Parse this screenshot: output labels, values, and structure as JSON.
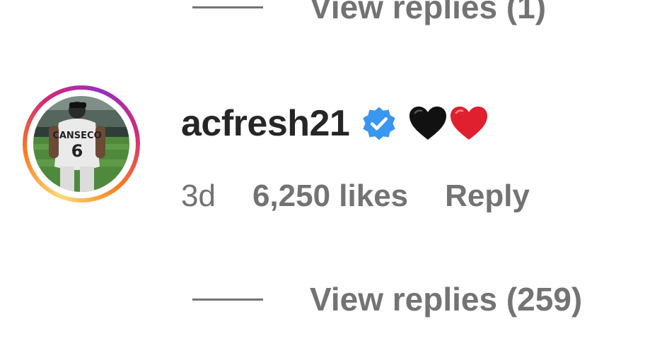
{
  "previous_thread": {
    "view_replies_label": "View replies (1)"
  },
  "comment": {
    "username": "acfresh21",
    "verified": true,
    "verified_icon": "verified-badge-icon",
    "body_icons": [
      "black-heart-icon",
      "red-heart-icon"
    ],
    "timestamp": "3d",
    "likes": "6,250 likes",
    "reply_label": "Reply",
    "view_replies_label": "View replies (259)"
  },
  "colors": {
    "text_primary": "#262626",
    "text_secondary": "#737373",
    "verified_blue": "#3897f0",
    "heart_red": "#e0202e",
    "heart_black": "#111111"
  }
}
